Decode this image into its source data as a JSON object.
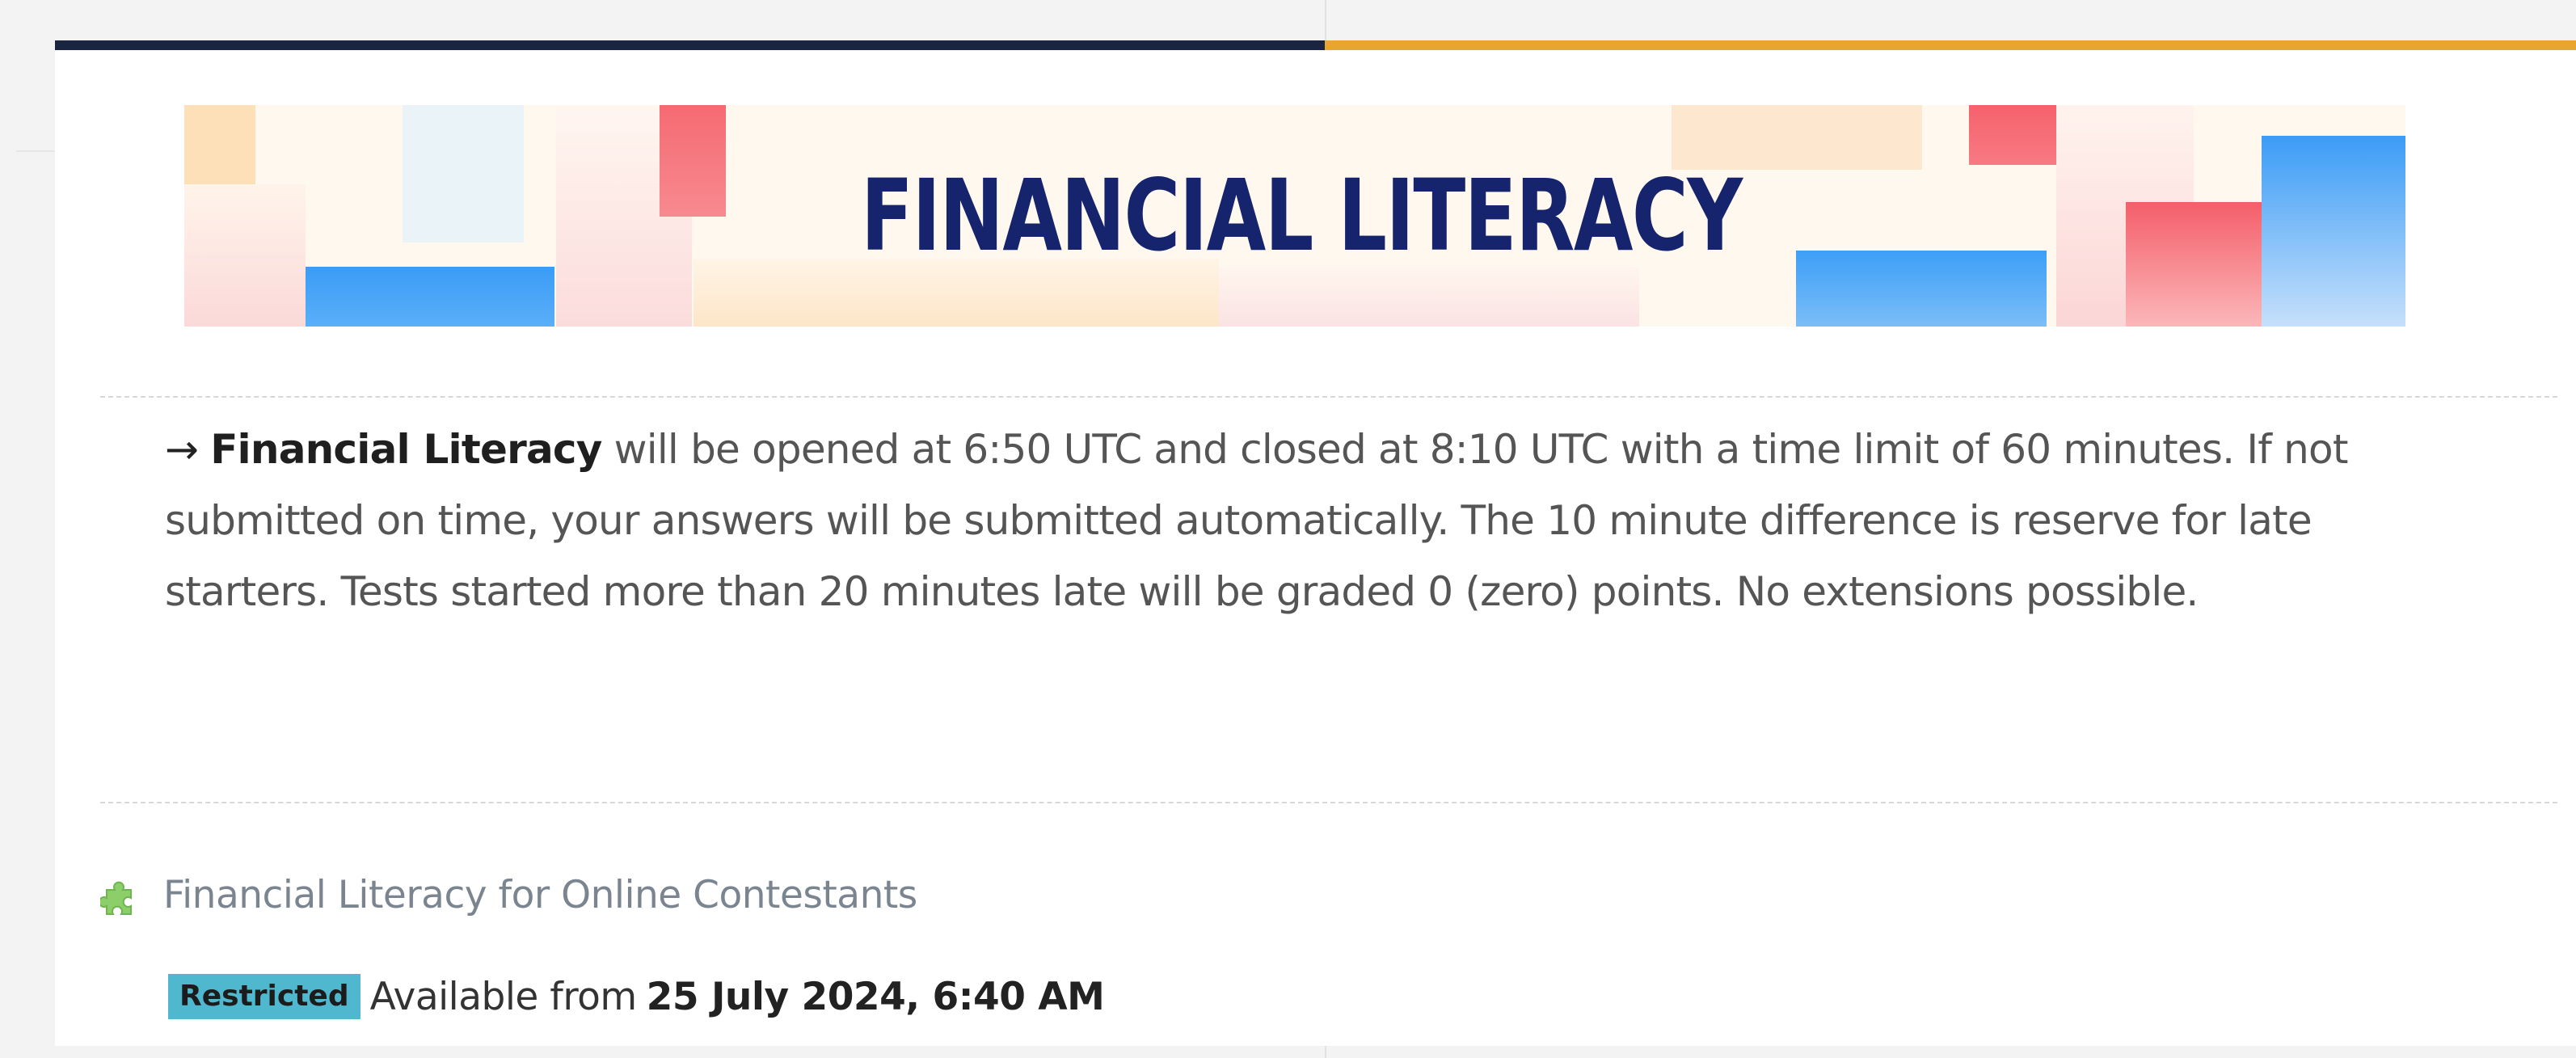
{
  "banner": {
    "title": "FINANCIAL LITERACY"
  },
  "description": {
    "arrow": "→",
    "title": "Financial Literacy",
    "line1": " will be opened at 6:50 UTC and closed at 8:10 UTC with a time limit of 60 minutes. If not",
    "line2": "submitted on time, your answers will be submitted automatically. The 10 minute difference is reserve for late",
    "line3": "starters. Tests started more than 20 minutes late will be graded 0 (zero) points. No extensions possible."
  },
  "activity": {
    "icon": "puzzle-icon",
    "name": "Financial Literacy for Online Contestants"
  },
  "restriction": {
    "badge": "Restricted",
    "text": "Available from",
    "date": "25 July 2024, 6:40 AM"
  },
  "colors": {
    "accent_dark": "#1b2440",
    "accent_orange": "#e8a530",
    "badge": "#4fb8cf",
    "banner_title": "#16246e"
  }
}
